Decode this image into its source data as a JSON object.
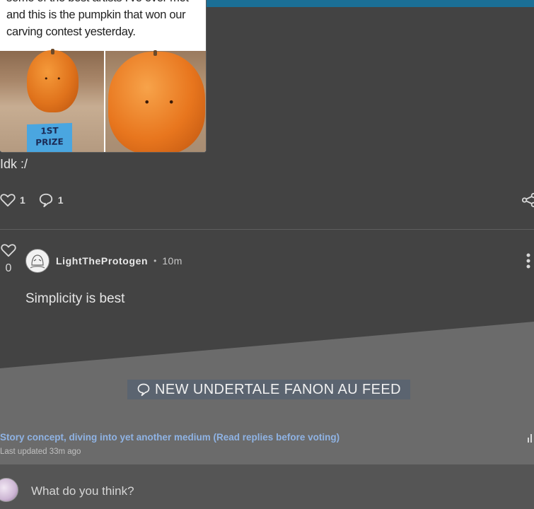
{
  "post": {
    "meme_caption_cut": "some of the best artists I've ever met",
    "meme_caption": "and this is the pumpkin that won our carving contest yesterday.",
    "prize_label": "1ST PRIZE",
    "text": "Idk :/",
    "like_count": "1",
    "comment_count": "1"
  },
  "comment": {
    "vote_count": "0",
    "username": "LightTheProtogen",
    "separator": "•",
    "time": "10m",
    "body": "Simplicity is best"
  },
  "feed": {
    "title": "NEW UNDERTALE FANON AU FEED",
    "topic_title": "Story concept, diving into yet another medium (Read replies before voting)",
    "topic_meta": "Last updated 33m ago"
  },
  "reply": {
    "placeholder": "What do you think?"
  },
  "colors": {
    "background": "#434343",
    "accent_bar": "#1b6f96",
    "link": "#8fb3e4",
    "pumpkin": "#e8761e"
  },
  "icons": [
    "heart-icon",
    "comment-icon",
    "share-icon",
    "more-vertical-icon",
    "comment-bubble-icon",
    "bar-chart-icon"
  ]
}
